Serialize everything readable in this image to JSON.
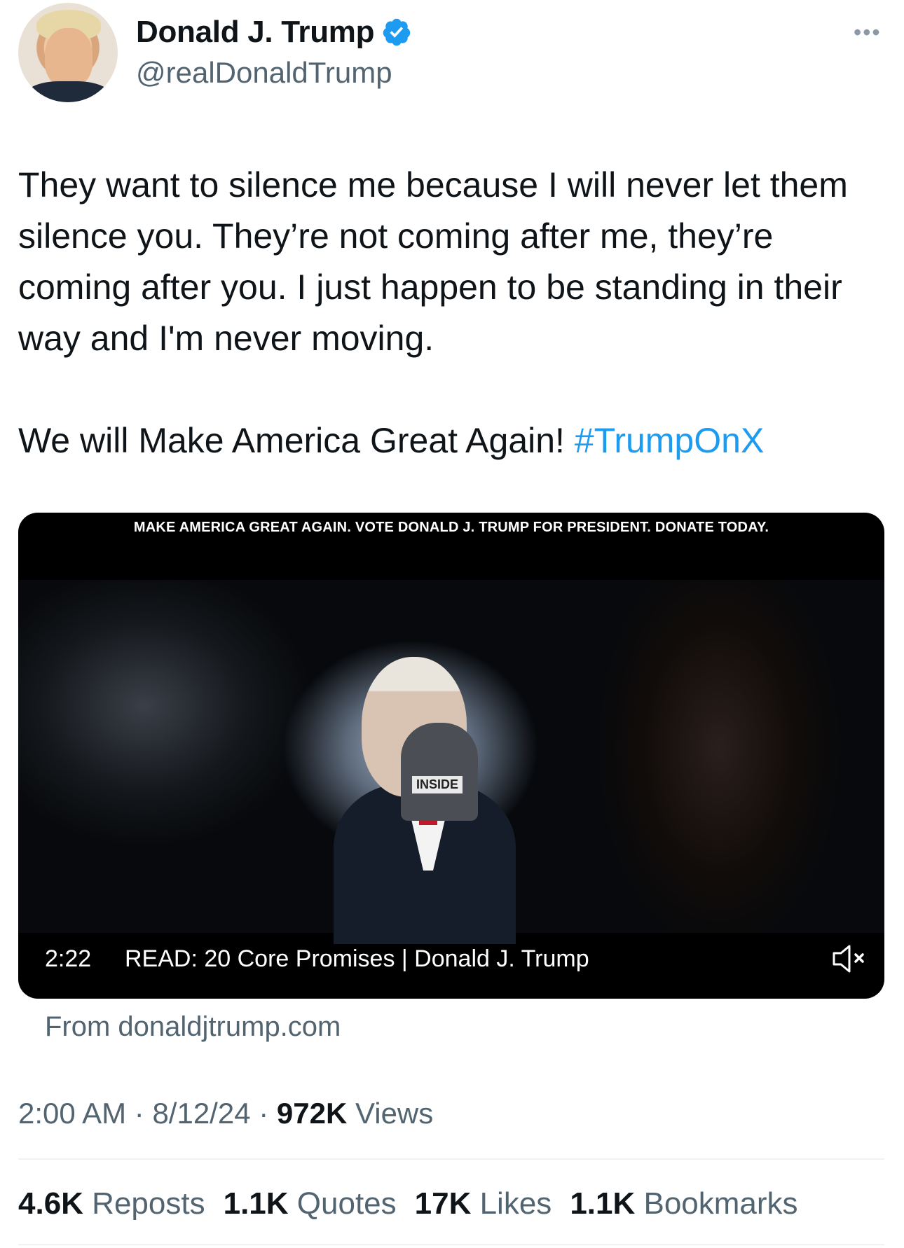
{
  "header": {
    "display_name": "Donald J. Trump",
    "handle": "@realDonaldTrump",
    "more_icon": "more-horizontal-icon",
    "more_glyph": "•••",
    "verified_color": "#1d9bf0"
  },
  "tweet": {
    "text_line": "They want to silence me because I will never let them silence you. They’re not coming after me, they’re coming after you. I just happen to be standing in their way and I'm never moving.",
    "maga_text": "We will Make America Great Again! ",
    "hashtag": "#TrumpOnX"
  },
  "video": {
    "banner": "MAKE AMERICA GREAT AGAIN. VOTE DONALD J. TRUMP FOR PRESIDENT. DONATE TODAY.",
    "duration": "2:22",
    "title": "READ: 20 Core Promises | Donald J. Trump",
    "mic_label": "INSIDE",
    "mute_icon": "mute-icon",
    "source": "From donaldjtrump.com"
  },
  "meta": {
    "time": "2:00 AM",
    "separator": " · ",
    "date": "8/12/24",
    "views_count": "972K",
    "views_label": " Views"
  },
  "stats": [
    {
      "num": "4.6K",
      "label": " Reposts"
    },
    {
      "num": "1.1K",
      "label": " Quotes"
    },
    {
      "num": "17K",
      "label": " Likes"
    },
    {
      "num": "1.1K",
      "label": " Bookmarks"
    }
  ],
  "colors": {
    "accent": "#1d9bf0",
    "muted": "#536471",
    "text": "#0f1419"
  }
}
